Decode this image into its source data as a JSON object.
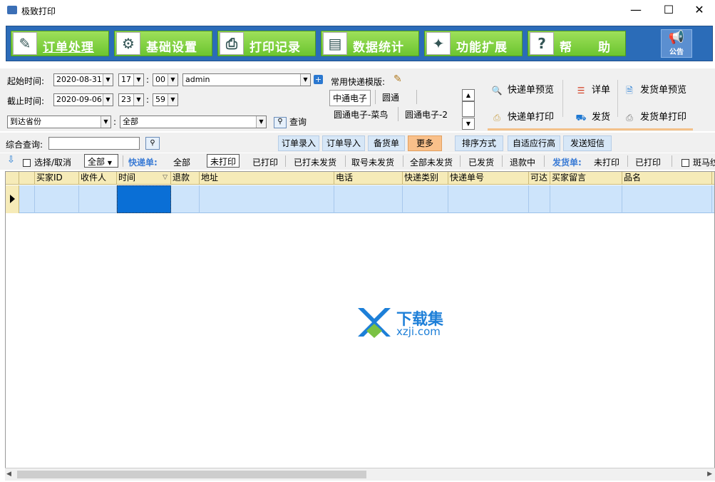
{
  "window": {
    "title": "极致打印"
  },
  "nav": {
    "items": [
      {
        "label": "订单处理",
        "icon": "order-icon"
      },
      {
        "label": "基础设置",
        "icon": "settings-gear-icon"
      },
      {
        "label": "打印记录",
        "icon": "print-record-icon"
      },
      {
        "label": "数据统计",
        "icon": "statistics-chart-icon"
      },
      {
        "label": "功能扩展",
        "icon": "extension-icon"
      },
      {
        "label": "帮　　助",
        "icon": "help-icon"
      }
    ],
    "notice_label": "公告"
  },
  "filters": {
    "start_label": "起始时间:",
    "start_date": "2020-08-31",
    "start_hour": "17",
    "start_min": "00",
    "user": "admin",
    "end_label": "截止时间:",
    "end_date": "2020-09-06",
    "end_hour": "23",
    "end_min": "59",
    "colon": ":",
    "province": "到达省份",
    "province_value": "全部",
    "query_label": "查询"
  },
  "templates": {
    "label": "常用快递模版:",
    "items": [
      "中通电子",
      "圆通",
      "圆通电子-菜鸟",
      "圆通电子-2"
    ]
  },
  "actions": {
    "express_preview": "快递单预览",
    "express_print": "快递单打印",
    "detail": "详单",
    "ship": "发货",
    "invoice_preview": "发货单预览",
    "invoice_print": "发货单打印"
  },
  "query_row": {
    "label": "综合查询:",
    "buttons": [
      "订单录入",
      "订单导入",
      "备货单",
      "更多",
      "排序方式",
      "自适应行高",
      "发送短信"
    ]
  },
  "filter_row": {
    "select_label": "选择/取消",
    "all_select": "全部",
    "express_label": "快递单:",
    "express_all": "全部",
    "express_unprinted": "未打印",
    "express_printed": "已打印",
    "printed_unshipped": "已打未发货",
    "took_unshipped": "取号未发货",
    "all_unshipped": "全部未发货",
    "shipped": "已发货",
    "refunding": "退款中",
    "invoice_label": "发货单:",
    "invoice_unprinted": "未打印",
    "invoice_printed": "已打印",
    "zebra": "斑马纹"
  },
  "grid": {
    "columns": [
      "买家ID",
      "收件人",
      "时间",
      "退款",
      "地址",
      "电话",
      "快递类别",
      "快递单号",
      "可达",
      "买家留言",
      "品名"
    ]
  },
  "watermark": {
    "title": "下载集",
    "url": "xzji.com"
  }
}
